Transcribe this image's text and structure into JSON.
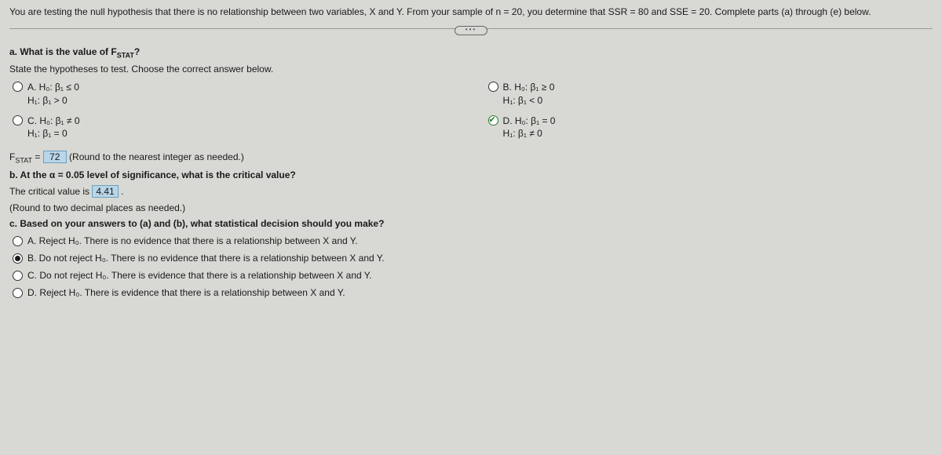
{
  "intro": "You are testing the null hypothesis that there is no relationship between two variables, X and Y. From your sample of n = 20, you determine that SSR = 80 and SSE = 20. Complete parts (a) through (e) below.",
  "a": {
    "prompt_pre": "a. What is the value of F",
    "prompt_sub": "STAT",
    "prompt_post": "?",
    "hyp_prompt": "State the hypotheses to test. Choose the correct answer below.",
    "opts": {
      "A": {
        "l1": "A.  H₀: β₁ ≤ 0",
        "l2": "     H₁: β₁ > 0"
      },
      "B": {
        "l1": "B.  H₀: β₁ ≥ 0",
        "l2": "     H₁: β₁ < 0"
      },
      "C": {
        "l1": "C.  H₀: β₁ ≠ 0",
        "l2": "     H₁: β₁ = 0"
      },
      "D": {
        "l1": "D.  H₀: β₁ = 0",
        "l2": "     H₁: β₁ ≠ 0"
      }
    },
    "fstat_pre": "F",
    "fstat_sub": "STAT",
    "fstat_mid": " = ",
    "fstat_val": "72",
    "fstat_hint": " (Round to the nearest integer as needed.)"
  },
  "b": {
    "prompt": "b. At the α = 0.05 level of significance, what is the critical value?",
    "ans_pre": "The critical value is ",
    "ans_val": "4.41",
    "ans_post": " .",
    "hint": "(Round to two decimal places as needed.)"
  },
  "c": {
    "prompt": "c. Based on your answers to (a) and (b), what statistical decision should you make?",
    "opts": {
      "A": "A.  Reject H₀. There is no evidence that there is a relationship between X and Y.",
      "B": "B.  Do not reject H₀. There is no evidence that there is a relationship between X and Y.",
      "C": "C.  Do not reject H₀. There is evidence that there is a relationship between X and Y.",
      "D": "D.  Reject H₀. There is evidence that there is a relationship between X and Y."
    }
  }
}
